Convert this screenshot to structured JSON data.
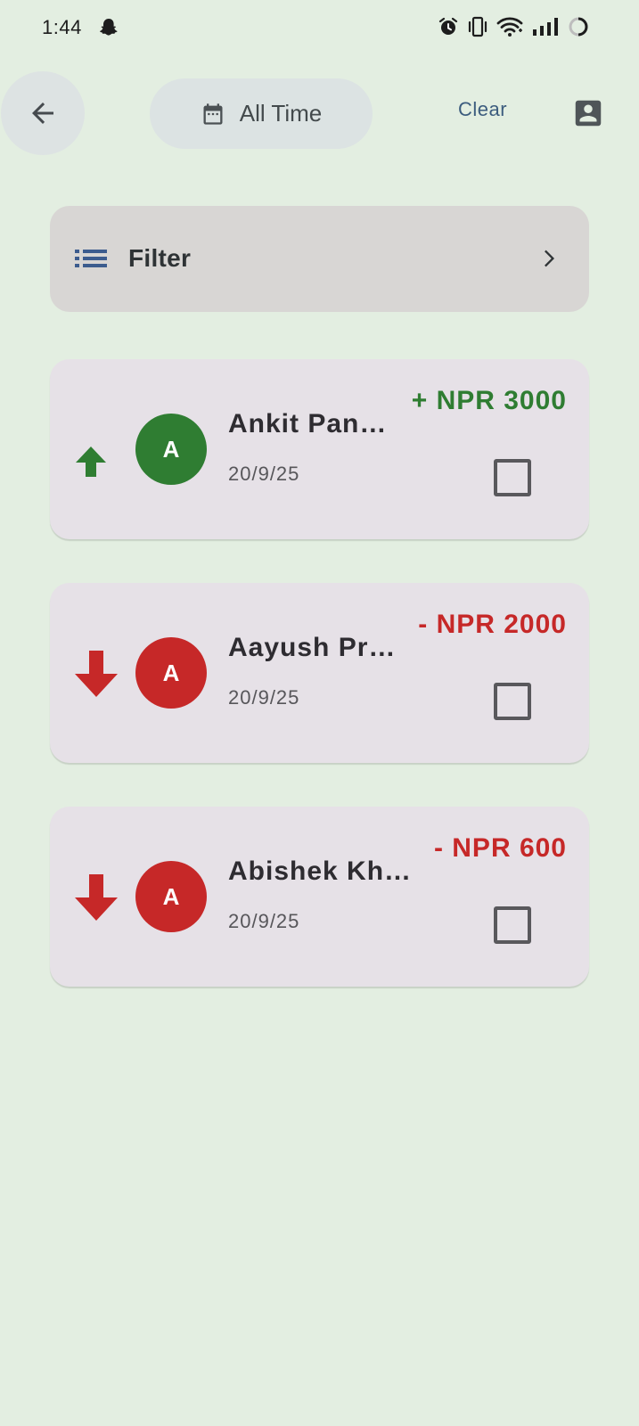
{
  "status_bar": {
    "time": "1:44",
    "icons": [
      "snapchat-icon",
      "alarm-icon",
      "vibrate-icon",
      "wifi-icon",
      "signal-icon",
      "battery-icon"
    ]
  },
  "header": {
    "back_icon": "arrow-back-icon",
    "date_filter_icon": "calendar-icon",
    "date_filter_label": "All Time",
    "clear_label": "Clear",
    "account_icon": "account-box-icon"
  },
  "filter": {
    "label": "Filter",
    "icon": "list-icon",
    "chevron": "chevron-right-icon"
  },
  "transactions": [
    {
      "direction": "up",
      "initial": "A",
      "name": "Ankit Pan…",
      "date": "20/9/25",
      "amount": "+ NPR 3000",
      "color": "#2f7d32",
      "checked": false
    },
    {
      "direction": "down",
      "initial": "A",
      "name": "Aayush Pr…",
      "date": "20/9/25",
      "amount": "- NPR 2000",
      "color": "#c62828",
      "checked": false
    },
    {
      "direction": "down",
      "initial": "A",
      "name": "Abishek Kh…",
      "date": "20/9/25",
      "amount": "- NPR 600",
      "color": "#c62828",
      "checked": false
    }
  ],
  "colors": {
    "background": "#e3eee1",
    "income": "#2f7d32",
    "expense": "#c62828",
    "accent": "#3c5c7e"
  }
}
